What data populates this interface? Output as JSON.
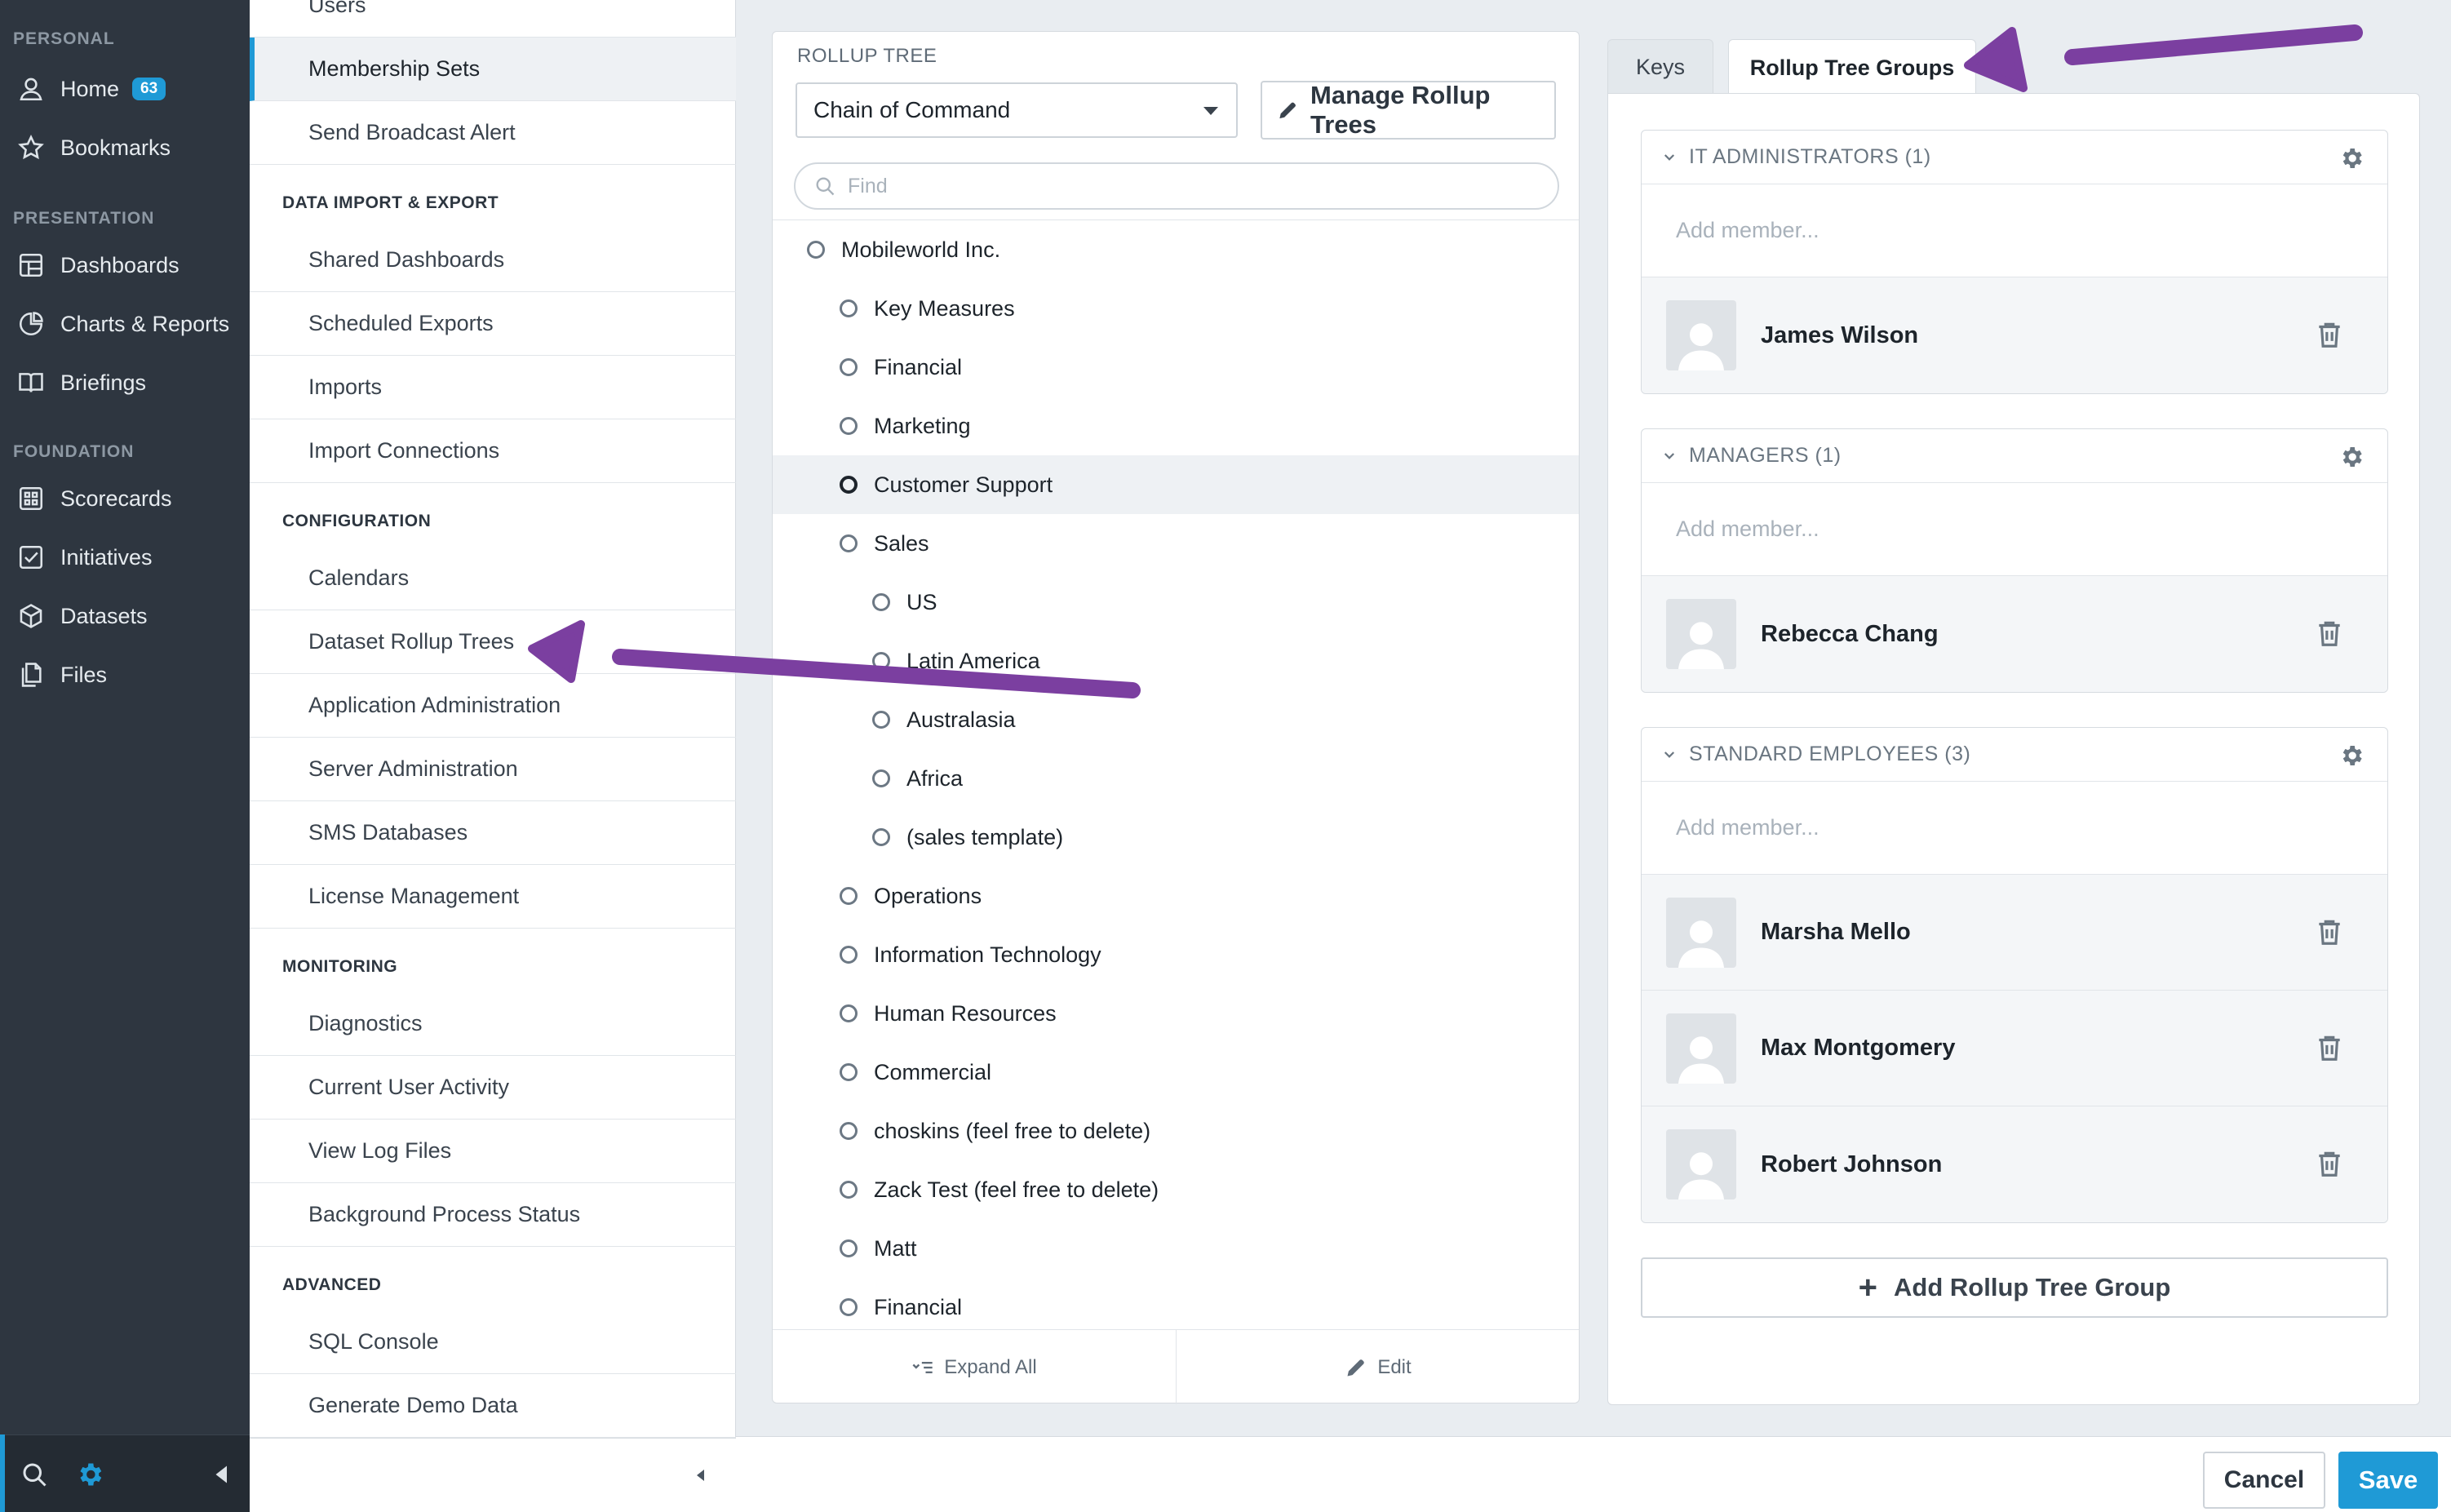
{
  "nav": {
    "sections": {
      "personal": "PERSONAL",
      "presentation": "PRESENTATION",
      "foundation": "FOUNDATION"
    },
    "items": [
      {
        "label": "Home",
        "icon": "user-icon",
        "badge": "63"
      },
      {
        "label": "Bookmarks",
        "icon": "star-icon"
      },
      {
        "label": "Dashboards",
        "icon": "dashboard-icon"
      },
      {
        "label": "Charts & Reports",
        "icon": "pie-chart-icon"
      },
      {
        "label": "Briefings",
        "icon": "book-icon"
      },
      {
        "label": "Scorecards",
        "icon": "scorecard-icon"
      },
      {
        "label": "Initiatives",
        "icon": "checkbox-icon"
      },
      {
        "label": "Datasets",
        "icon": "cube-icon"
      },
      {
        "label": "Files",
        "icon": "files-icon"
      }
    ],
    "bottom_icons": [
      "search-icon",
      "gear-icon",
      "collapse-left-icon"
    ],
    "accent": "#1f9ad6",
    "background": "#2e3640"
  },
  "admin": {
    "top_items": [
      {
        "label": "Users"
      },
      {
        "label": "Membership Sets",
        "active": true
      },
      {
        "label": "Send Broadcast Alert"
      }
    ],
    "sections": [
      {
        "heading": "DATA IMPORT & EXPORT",
        "items": [
          "Shared Dashboards",
          "Scheduled Exports",
          "Imports",
          "Import Connections"
        ]
      },
      {
        "heading": "CONFIGURATION",
        "items": [
          "Calendars",
          "Dataset Rollup Trees",
          "Application Administration",
          "Server Administration",
          "SMS Databases",
          "License Management"
        ]
      },
      {
        "heading": "MONITORING",
        "items": [
          "Diagnostics",
          "Current User Activity",
          "View Log Files",
          "Background Process Status"
        ]
      },
      {
        "heading": "ADVANCED",
        "items": [
          "SQL Console",
          "Generate Demo Data"
        ]
      }
    ]
  },
  "rollup": {
    "label": "ROLLUP TREE",
    "selected_tree": "Chain of Command",
    "manage_label": "Manage Rollup Trees",
    "search_placeholder": "Find",
    "nodes": [
      {
        "label": "Mobileworld Inc.",
        "level": 0
      },
      {
        "label": "Key Measures",
        "level": 1
      },
      {
        "label": "Financial",
        "level": 1
      },
      {
        "label": "Marketing",
        "level": 1
      },
      {
        "label": "Customer Support",
        "level": 1,
        "selected": true
      },
      {
        "label": "Sales",
        "level": 1
      },
      {
        "label": "US",
        "level": 2
      },
      {
        "label": "Latin America",
        "level": 2
      },
      {
        "label": "Australasia",
        "level": 2
      },
      {
        "label": "Africa",
        "level": 2
      },
      {
        "label": "(sales template)",
        "level": 2
      },
      {
        "label": "Operations",
        "level": 1
      },
      {
        "label": "Information Technology",
        "level": 1
      },
      {
        "label": "Human Resources",
        "level": 1
      },
      {
        "label": "Commercial",
        "level": 1
      },
      {
        "label": "choskins (feel free to delete)",
        "level": 1
      },
      {
        "label": "Zack Test (feel free to delete)",
        "level": 1
      },
      {
        "label": "Matt",
        "level": 1
      },
      {
        "label": "Financial",
        "level": 1
      }
    ],
    "expand_all_label": "Expand All",
    "edit_label": "Edit"
  },
  "tabs": [
    {
      "label": "Keys",
      "active": false
    },
    {
      "label": "Rollup Tree Groups",
      "active": true
    }
  ],
  "groups": [
    {
      "name": "IT ADMINISTRATORS (1)",
      "add_placeholder": "Add member...",
      "members": [
        "James Wilson"
      ]
    },
    {
      "name": "MANAGERS (1)",
      "add_placeholder": "Add member...",
      "members": [
        "Rebecca Chang"
      ]
    },
    {
      "name": "STANDARD EMPLOYEES (3)",
      "add_placeholder": "Add member...",
      "members": [
        "Marsha Mello",
        "Max Montgomery",
        "Robert Johnson"
      ]
    }
  ],
  "add_group_label": "Add Rollup Tree Group",
  "actions": {
    "cancel": "Cancel",
    "save": "Save"
  },
  "annotation_color": "#7b3fa0"
}
